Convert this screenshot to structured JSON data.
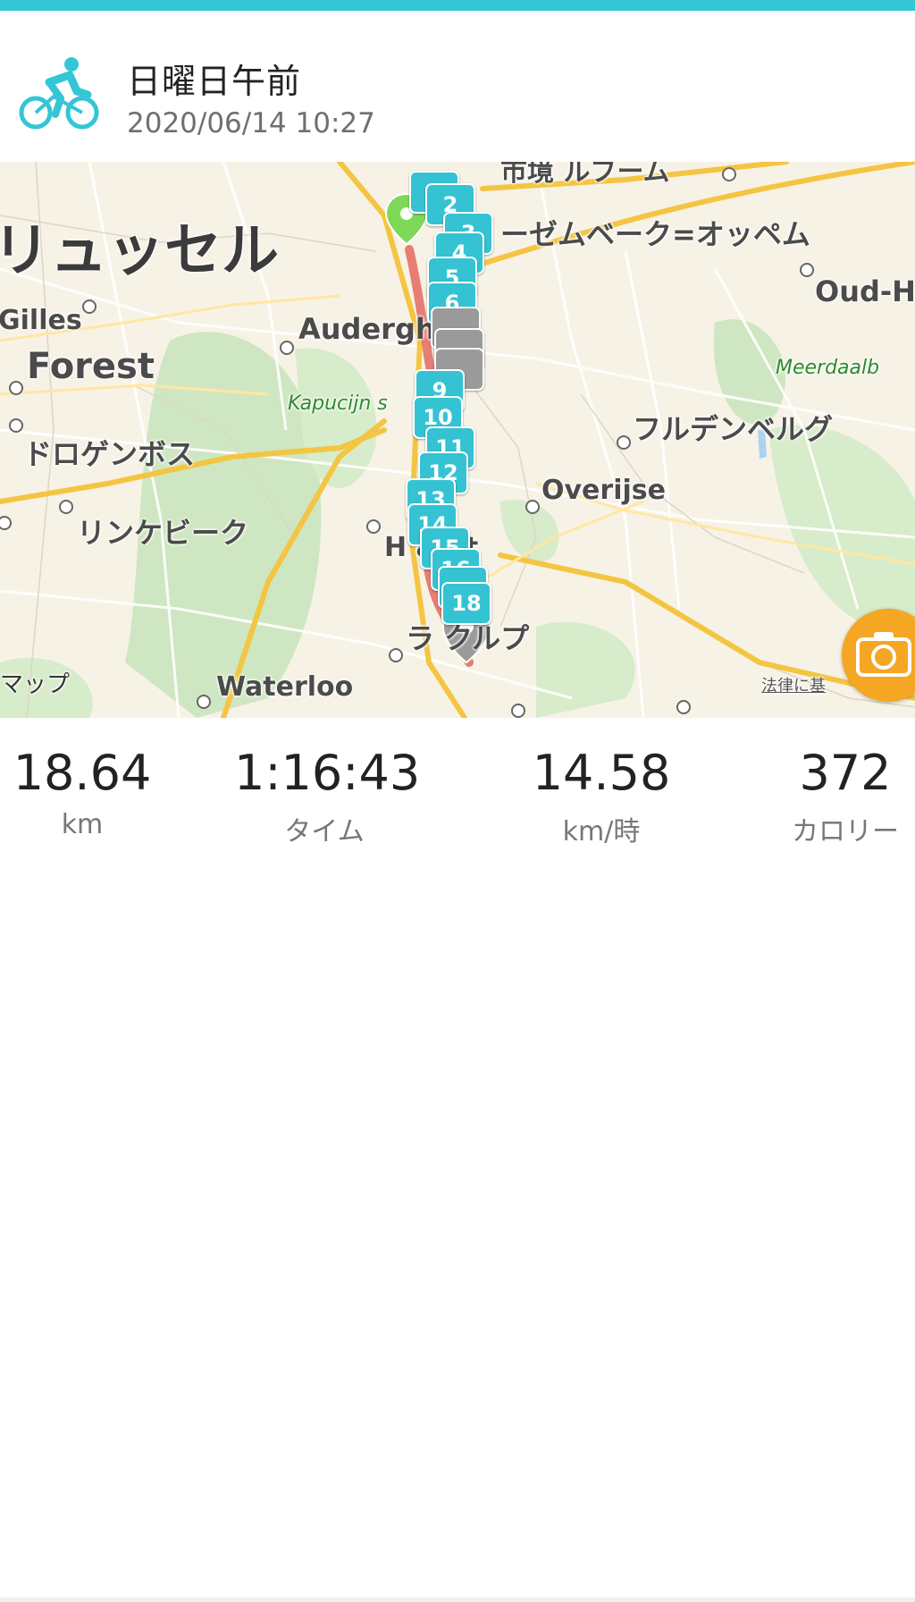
{
  "header": {
    "title": "日曜日午前",
    "datetime": "2020/06/14 10:27",
    "activity_icon": "cycling-icon",
    "accent_color": "#34c5d6"
  },
  "map": {
    "labels": {
      "city": "リュッセル",
      "gilles": "Gilles",
      "forest": "Forest",
      "auderghem": "Audergh  m",
      "kapucijnenbos": "Kapucijn      s",
      "drogenbos": "ドロゲンボス",
      "linkebeek": "リンケビーク",
      "hoeilaart": "H       aart",
      "overijse": "Overijse",
      "huldenberg": "フルデンベルグ",
      "meerdaal": "Meerdaalb",
      "oud_heverlee": "Oud-H",
      "zaventem": "ーゼムベーク=オッペム",
      "top_label": "市境      ルブーム",
      "lasne": "ラ  クルプ",
      "waterloo": "Waterloo",
      "maps_brand": "マップ",
      "legal": "法律に基"
    },
    "markers": [
      "2",
      "3",
      "4",
      "5",
      "6",
      "9",
      "10",
      "11",
      "12",
      "13",
      "14",
      "15",
      "16",
      "18"
    ],
    "start_color": "#7ed957",
    "end_color": "#9a9a9a",
    "marker_color": "#35c3d3",
    "camera_button_color": "#f5a623"
  },
  "stats": [
    {
      "value": "18.64",
      "unit": "km"
    },
    {
      "value": "1:16:43",
      "unit": "タイム"
    },
    {
      "value": "14.58",
      "unit": "km/時"
    },
    {
      "value": "372",
      "unit": "カロリー"
    }
  ]
}
